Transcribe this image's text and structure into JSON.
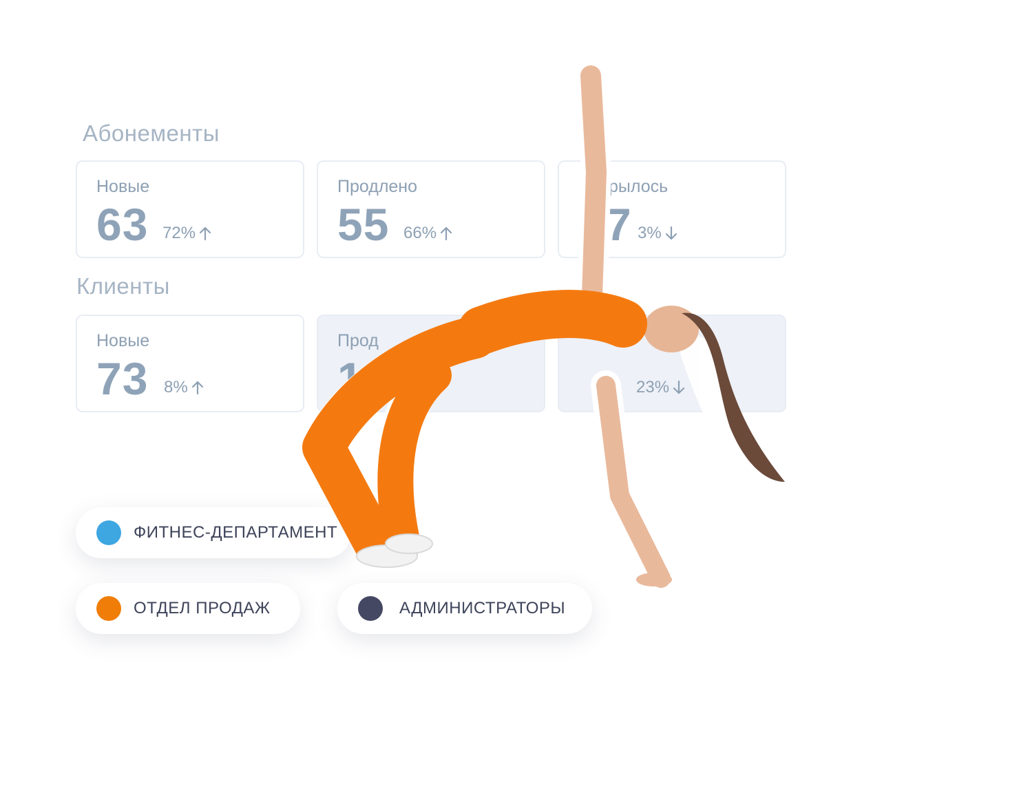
{
  "sections": [
    {
      "title": "Абонементы",
      "cards": [
        {
          "label": "Новые",
          "value": "63",
          "delta": "72%",
          "trend": "up"
        },
        {
          "label": "Продлено",
          "value": "55",
          "delta": "66%",
          "trend": "up"
        },
        {
          "label": "рылось",
          "value": "7",
          "delta": "3%",
          "trend": "down"
        }
      ]
    },
    {
      "title": "Клиенты",
      "cards": [
        {
          "label": "Новые",
          "value": "73",
          "delta": "8%",
          "trend": "up"
        },
        {
          "label": "Прод",
          "value": "1",
          "delta": "",
          "trend": ""
        },
        {
          "label": "",
          "value": "",
          "delta": "23%",
          "trend": "down"
        }
      ]
    }
  ],
  "departments": [
    {
      "label": "ФИТНЕС-ДЕПАРТАМЕНТ",
      "color": "#3ea6e0"
    },
    {
      "label": "ОТДЕЛ ПРОДАЖ",
      "color": "#f07d07"
    },
    {
      "label": "АДМИНИСТРАТОРЫ",
      "color": "#454863"
    }
  ],
  "colors": {
    "muted_text": "#8da0b3",
    "card_border": "#e8ecf3",
    "outfit": "#f47a10"
  },
  "icons": {
    "up": "arrow-up-icon",
    "down": "arrow-down-icon"
  }
}
